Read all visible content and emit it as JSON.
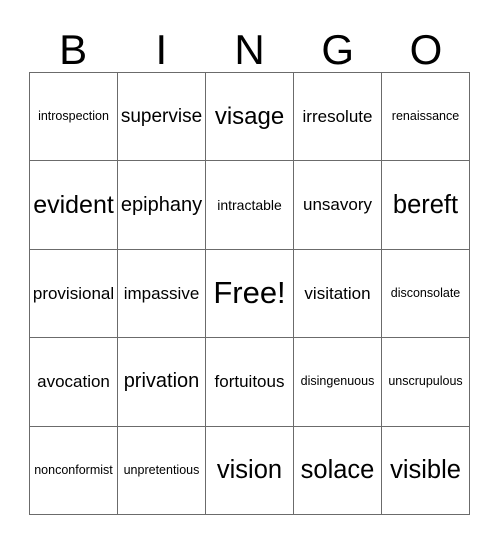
{
  "card": {
    "header_letters": [
      "B",
      "I",
      "N",
      "G",
      "O"
    ],
    "free_space_label": "Free!",
    "colors": {
      "background": "#ffffff",
      "text": "#000000",
      "grid_line": "#6b6b6b"
    },
    "grid": {
      "columns": 5,
      "rows": 5,
      "cells": [
        [
          {
            "text": "introspection",
            "size": "xs"
          },
          {
            "text": "supervise",
            "size": "l"
          },
          {
            "text": "visage",
            "size": "xl"
          },
          {
            "text": "irresolute",
            "size": "m"
          },
          {
            "text": "renaissance",
            "size": "xs"
          }
        ],
        [
          {
            "text": "evident",
            "size": "xxl"
          },
          {
            "text": "epiphany",
            "size": "l"
          },
          {
            "text": "intractable",
            "size": "s"
          },
          {
            "text": "unsavory",
            "size": "m"
          },
          {
            "text": "bereft",
            "size": "xxl"
          }
        ],
        [
          {
            "text": "provisional",
            "size": "m"
          },
          {
            "text": "impassive",
            "size": "m"
          },
          {
            "text": "Free!",
            "size": "free"
          },
          {
            "text": "visitation",
            "size": "m"
          },
          {
            "text": "disconsolate",
            "size": "xs"
          }
        ],
        [
          {
            "text": "avocation",
            "size": "m"
          },
          {
            "text": "privation",
            "size": "l"
          },
          {
            "text": "fortuitous",
            "size": "m"
          },
          {
            "text": "disingenuous",
            "size": "xs"
          },
          {
            "text": "unscrupulous",
            "size": "xs"
          }
        ],
        [
          {
            "text": "nonconformist",
            "size": "xs"
          },
          {
            "text": "unpretentious",
            "size": "xs"
          },
          {
            "text": "vision",
            "size": "xxl"
          },
          {
            "text": "solace",
            "size": "xxl"
          },
          {
            "text": "visible",
            "size": "xxl"
          }
        ]
      ]
    }
  }
}
